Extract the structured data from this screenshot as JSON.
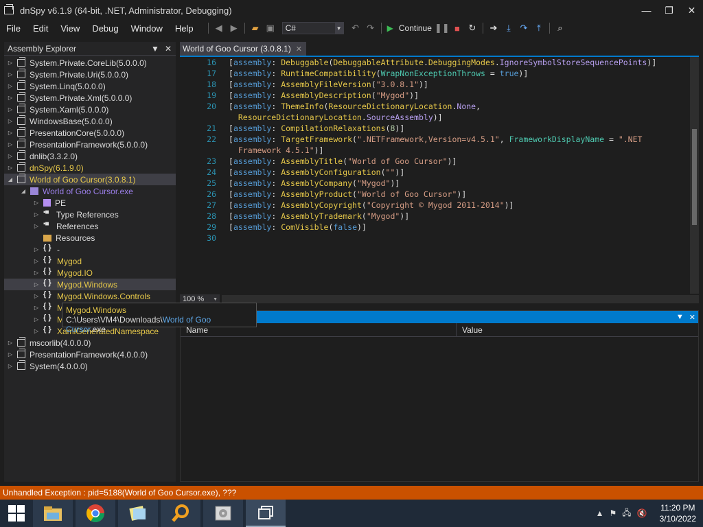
{
  "window": {
    "title": "dnSpy v6.1.9 (64-bit, .NET, Administrator, Debugging)",
    "min_glyph": "—",
    "max_glyph": "❐",
    "close_glyph": "✕"
  },
  "menu": [
    "File",
    "Edit",
    "View",
    "Debug",
    "Window",
    "Help"
  ],
  "toolbar": {
    "language": "C#",
    "continue_label": "Continue"
  },
  "assembly_explorer": {
    "title": "Assembly Explorer",
    "items": [
      {
        "label": "System.Private.CoreLib",
        "ver": " (5.0.0.0)",
        "level": 0,
        "icon": "asm",
        "arrow": "▷"
      },
      {
        "label": "System.Private.Uri",
        "ver": " (5.0.0.0)",
        "level": 0,
        "icon": "asm",
        "arrow": "▷"
      },
      {
        "label": "System.Linq",
        "ver": " (5.0.0.0)",
        "level": 0,
        "icon": "asm",
        "arrow": "▷"
      },
      {
        "label": "System.Private.Xml",
        "ver": " (5.0.0.0)",
        "level": 0,
        "icon": "asm",
        "arrow": "▷"
      },
      {
        "label": "System.Xaml",
        "ver": " (5.0.0.0)",
        "level": 0,
        "icon": "asm",
        "arrow": "▷"
      },
      {
        "label": "WindowsBase",
        "ver": " (5.0.0.0)",
        "level": 0,
        "icon": "asm",
        "arrow": "▷"
      },
      {
        "label": "PresentationCore",
        "ver": " (5.0.0.0)",
        "level": 0,
        "icon": "asm",
        "arrow": "▷"
      },
      {
        "label": "PresentationFramework",
        "ver": " (5.0.0.0)",
        "level": 0,
        "icon": "asm",
        "arrow": "▷"
      },
      {
        "label": "dnlib",
        "ver": " (3.3.2.0)",
        "level": 0,
        "icon": "asm",
        "arrow": "▷"
      },
      {
        "label": "dnSpy",
        "ver": " (6.1.9.0)",
        "level": 0,
        "icon": "asm",
        "arrow": "▷",
        "color": "yellow"
      },
      {
        "label": "World of Goo Cursor",
        "ver": " (3.0.8.1)",
        "level": 0,
        "icon": "asm",
        "arrow": "◢",
        "color": "yellow",
        "highlight": true
      },
      {
        "label": "World of Goo Cursor.exe",
        "ver": "",
        "level": 1,
        "icon": "module",
        "arrow": "◢",
        "color": "purple"
      },
      {
        "label": "PE",
        "ver": "",
        "level": 2,
        "icon": "pe",
        "arrow": "▷"
      },
      {
        "label": "Type References",
        "ver": "",
        "level": 2,
        "icon": "refs",
        "arrow": "▷"
      },
      {
        "label": "References",
        "ver": "",
        "level": 2,
        "icon": "refs",
        "arrow": "▷"
      },
      {
        "label": "Resources",
        "ver": "",
        "level": 2,
        "icon": "folder",
        "arrow": ""
      },
      {
        "label": "-",
        "ver": "",
        "level": 2,
        "icon": "ns",
        "arrow": "▷"
      },
      {
        "label": "Mygod",
        "ver": "",
        "level": 2,
        "icon": "ns",
        "arrow": "▷",
        "color": "yellow"
      },
      {
        "label": "Mygod.IO",
        "ver": "",
        "level": 2,
        "icon": "ns",
        "arrow": "▷",
        "color": "yellow"
      },
      {
        "label": "Mygod.Windows",
        "ver": "",
        "level": 2,
        "icon": "ns",
        "arrow": "▷",
        "color": "yellow",
        "selected": true
      },
      {
        "label": "Mygod.Windows.Controls",
        "ver": "",
        "level": 2,
        "icon": "ns",
        "arrow": "▷",
        "color": "yellow"
      },
      {
        "label": "M",
        "ver": "",
        "level": 2,
        "icon": "ns",
        "arrow": "▷",
        "color": "yellow"
      },
      {
        "label": "M",
        "ver": "",
        "level": 2,
        "icon": "ns",
        "arrow": "▷",
        "color": "yellow"
      },
      {
        "label": "XamlGeneratedNamespace",
        "ver": "",
        "level": 2,
        "icon": "ns",
        "arrow": "▷",
        "color": "yellow"
      },
      {
        "label": "mscorlib",
        "ver": " (4.0.0.0)",
        "level": 0,
        "icon": "asm",
        "arrow": "▷"
      },
      {
        "label": "PresentationFramework",
        "ver": " (4.0.0.0)",
        "level": 0,
        "icon": "asm",
        "arrow": "▷"
      },
      {
        "label": "System",
        "ver": " (4.0.0.0)",
        "level": 0,
        "icon": "asm",
        "arrow": "▷"
      }
    ]
  },
  "tooltip": {
    "title": "Mygod.Windows",
    "path_prefix": "C:\\Users\\VM4\\Downloads\\",
    "path_file": "World of Goo Cursor",
    "path_ext": ".exe"
  },
  "editor_tab": {
    "label": "World of Goo Cursor (3.0.8.1)"
  },
  "code_lines": [
    {
      "n": "16",
      "t": [
        [
          "[",
          "p"
        ],
        [
          "assembly",
          "k"
        ],
        [
          ": ",
          "p"
        ],
        [
          "Debuggable",
          "t"
        ],
        [
          "(",
          "p"
        ],
        [
          "DebuggableAttribute",
          "t"
        ],
        [
          ".",
          "p"
        ],
        [
          "DebuggingModes",
          "t"
        ],
        [
          ".",
          "p"
        ],
        [
          "IgnoreSymbolStoreSequencePoints",
          "e"
        ],
        [
          ")]",
          "p"
        ]
      ]
    },
    {
      "n": "17",
      "t": [
        [
          "[",
          "p"
        ],
        [
          "assembly",
          "k"
        ],
        [
          ": ",
          "p"
        ],
        [
          "RuntimeCompatibility",
          "t"
        ],
        [
          "(",
          "p"
        ],
        [
          "WrapNonExceptionThrows",
          "pr"
        ],
        [
          " = ",
          "p"
        ],
        [
          "true",
          "k"
        ],
        [
          ")]",
          "p"
        ]
      ]
    },
    {
      "n": "18",
      "t": [
        [
          "[",
          "p"
        ],
        [
          "assembly",
          "k"
        ],
        [
          ": ",
          "p"
        ],
        [
          "AssemblyFileVersion",
          "t"
        ],
        [
          "(",
          "p"
        ],
        [
          "\"3.0.8.1\"",
          "s"
        ],
        [
          ")]",
          "p"
        ]
      ]
    },
    {
      "n": "19",
      "t": [
        [
          "[",
          "p"
        ],
        [
          "assembly",
          "k"
        ],
        [
          ": ",
          "p"
        ],
        [
          "AssemblyDescription",
          "t"
        ],
        [
          "(",
          "p"
        ],
        [
          "\"Mygod\"",
          "s"
        ],
        [
          ")]",
          "p"
        ]
      ]
    },
    {
      "n": "20",
      "t": [
        [
          "[",
          "p"
        ],
        [
          "assembly",
          "k"
        ],
        [
          ": ",
          "p"
        ],
        [
          "ThemeInfo",
          "t"
        ],
        [
          "(",
          "p"
        ],
        [
          "ResourceDictionaryLocation",
          "t"
        ],
        [
          ".",
          "p"
        ],
        [
          "None",
          "e"
        ],
        [
          ",",
          "p"
        ]
      ]
    },
    {
      "n": "",
      "t": [
        [
          "  ResourceDictionaryLocation",
          "t"
        ],
        [
          ".",
          "p"
        ],
        [
          "SourceAssembly",
          "e"
        ],
        [
          ")]",
          "p"
        ]
      ]
    },
    {
      "n": "21",
      "t": [
        [
          "[",
          "p"
        ],
        [
          "assembly",
          "k"
        ],
        [
          ": ",
          "p"
        ],
        [
          "CompilationRelaxations",
          "t"
        ],
        [
          "(",
          "p"
        ],
        [
          "8",
          "n"
        ],
        [
          ")]",
          "p"
        ]
      ]
    },
    {
      "n": "22",
      "t": [
        [
          "[",
          "p"
        ],
        [
          "assembly",
          "k"
        ],
        [
          ": ",
          "p"
        ],
        [
          "TargetFramework",
          "t"
        ],
        [
          "(",
          "p"
        ],
        [
          "\".NETFramework,Version=v4.5.1\"",
          "s"
        ],
        [
          ", ",
          "p"
        ],
        [
          "FrameworkDisplayName",
          "pr"
        ],
        [
          " = ",
          "p"
        ],
        [
          "\".NET",
          "s"
        ]
      ]
    },
    {
      "n": "",
      "t": [
        [
          "  Framework 4.5.1\"",
          "s"
        ],
        [
          ")]",
          "p"
        ]
      ]
    },
    {
      "n": "23",
      "t": [
        [
          "[",
          "p"
        ],
        [
          "assembly",
          "k"
        ],
        [
          ": ",
          "p"
        ],
        [
          "AssemblyTitle",
          "t"
        ],
        [
          "(",
          "p"
        ],
        [
          "\"World of Goo Cursor\"",
          "s"
        ],
        [
          ")]",
          "p"
        ]
      ]
    },
    {
      "n": "24",
      "t": [
        [
          "[",
          "p"
        ],
        [
          "assembly",
          "k"
        ],
        [
          ": ",
          "p"
        ],
        [
          "AssemblyConfiguration",
          "t"
        ],
        [
          "(",
          "p"
        ],
        [
          "\"\"",
          "s"
        ],
        [
          ")]",
          "p"
        ]
      ]
    },
    {
      "n": "25",
      "t": [
        [
          "[",
          "p"
        ],
        [
          "assembly",
          "k"
        ],
        [
          ": ",
          "p"
        ],
        [
          "AssemblyCompany",
          "t"
        ],
        [
          "(",
          "p"
        ],
        [
          "\"Mygod\"",
          "s"
        ],
        [
          ")]",
          "p"
        ]
      ]
    },
    {
      "n": "26",
      "t": [
        [
          "[",
          "p"
        ],
        [
          "assembly",
          "k"
        ],
        [
          ": ",
          "p"
        ],
        [
          "AssemblyProduct",
          "t"
        ],
        [
          "(",
          "p"
        ],
        [
          "\"World of Goo Cursor\"",
          "s"
        ],
        [
          ")]",
          "p"
        ]
      ]
    },
    {
      "n": "27",
      "t": [
        [
          "[",
          "p"
        ],
        [
          "assembly",
          "k"
        ],
        [
          ": ",
          "p"
        ],
        [
          "AssemblyCopyright",
          "t"
        ],
        [
          "(",
          "p"
        ],
        [
          "\"Copyright © Mygod 2011-2014\"",
          "s"
        ],
        [
          ")]",
          "p"
        ]
      ]
    },
    {
      "n": "28",
      "t": [
        [
          "[",
          "p"
        ],
        [
          "assembly",
          "k"
        ],
        [
          ": ",
          "p"
        ],
        [
          "AssemblyTrademark",
          "t"
        ],
        [
          "(",
          "p"
        ],
        [
          "\"Mygod\"",
          "s"
        ],
        [
          ")]",
          "p"
        ]
      ]
    },
    {
      "n": "29",
      "t": [
        [
          "[",
          "p"
        ],
        [
          "assembly",
          "k"
        ],
        [
          ": ",
          "p"
        ],
        [
          "ComVisible",
          "t"
        ],
        [
          "(",
          "p"
        ],
        [
          "false",
          "k"
        ],
        [
          ")]",
          "p"
        ]
      ]
    },
    {
      "n": "30",
      "t": []
    }
  ],
  "syntax_colors": {
    "p": "#dcdcdc",
    "k": "#569cd6",
    "t": "#e6c84a",
    "s": "#d69d85",
    "e": "#b8a0f0",
    "pr": "#4ec9b0",
    "n": "#b5cea8"
  },
  "zoom": "100 %",
  "locals": {
    "col_name": "Name",
    "col_value": "Value"
  },
  "status": {
    "text": "Unhandled Exception : pid=5188(World of Goo Cursor.exe), ???"
  },
  "clock": {
    "time": "11:20 PM",
    "date": "3/10/2022"
  }
}
